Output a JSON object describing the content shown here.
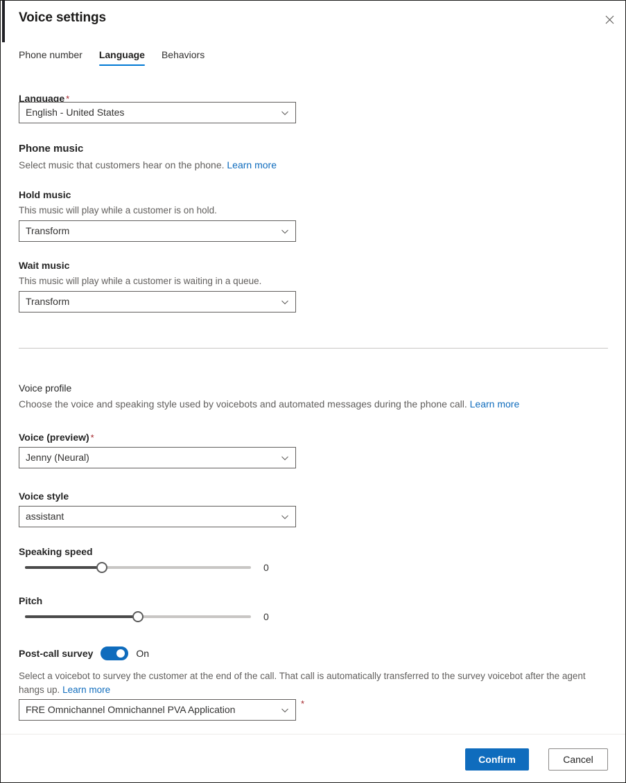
{
  "dialog": {
    "title": "Voice settings",
    "close_icon": "close-icon"
  },
  "tabs": [
    {
      "label": "Phone number",
      "active": false
    },
    {
      "label": "Language",
      "active": true
    },
    {
      "label": "Behaviors",
      "active": false
    }
  ],
  "language_field": {
    "label": "Language",
    "required_mark": "*",
    "value": "English - United States",
    "caret_icon": "chevron-down-icon"
  },
  "phone_music": {
    "heading": "Phone music",
    "description": "Select music that customers hear on the phone.",
    "learn_more": "Learn more",
    "hold_music": {
      "label": "Hold music",
      "hint": "This music will play while a customer is on hold.",
      "value": "Transform"
    },
    "wait_music": {
      "label": "Wait music",
      "hint": "This music will play while a customer is waiting in a queue.",
      "value": "Transform"
    }
  },
  "voice_profile": {
    "heading": "Voice profile",
    "description": "Choose the voice and speaking style used by voicebots and automated messages during the phone call.",
    "learn_more": "Learn more",
    "voice": {
      "label": "Voice (preview)",
      "required_mark": "*",
      "value": "Jenny (Neural)"
    },
    "voice_style": {
      "label": "Voice style",
      "value": "assistant"
    },
    "speaking_speed": {
      "label": "Speaking speed",
      "value": "0",
      "percent": 34
    },
    "pitch": {
      "label": "Pitch",
      "value": "0",
      "percent": 50
    }
  },
  "post_call_survey": {
    "label": "Post-call survey",
    "toggle_state": "On",
    "toggle_on": true,
    "description": "Select a voicebot to survey the customer at the end of the call. That call is automatically transferred to the survey voicebot after the agent hangs up.",
    "learn_more": "Learn more",
    "voicebot": {
      "value": "FRE Omnichannel Omnichannel PVA Application",
      "required_mark": "*"
    }
  },
  "footer": {
    "confirm_label": "Confirm",
    "cancel_label": "Cancel"
  },
  "colors": {
    "accent": "#0f6cbd",
    "tab_underline": "#0078d4",
    "required": "#a4262c",
    "link": "#0f6cbd",
    "text": "#242424",
    "muted": "#605e5c",
    "border": "#605e5c",
    "divider": "#c8c6c4"
  }
}
